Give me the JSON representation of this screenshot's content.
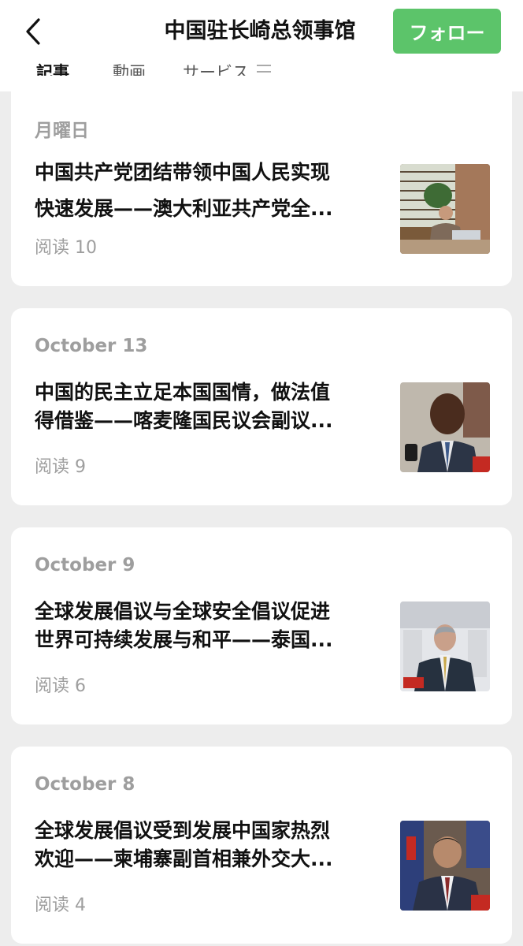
{
  "header": {
    "title": "中国驻长崎总领事馆",
    "follow_label": "フォロー",
    "back_icon": "chevron-left-icon"
  },
  "tabs": [
    {
      "label": "記事",
      "active": true
    },
    {
      "label": "動画",
      "active": false
    },
    {
      "label": "サービス",
      "active": false
    }
  ],
  "articles": [
    {
      "date": "月曜日",
      "title_line1": "中国共产党团结带领中国人民实现",
      "title_line2": "快速发展——澳大利亚共产党全...",
      "reads": "阅读 10"
    },
    {
      "date": "October 13",
      "title_line1": "中国的民主立足本国国情，做法值",
      "title_line2": "得借鉴——喀麦隆国民议会副议...",
      "reads": "阅读 9"
    },
    {
      "date": "October 9",
      "title_line1": "全球发展倡议与全球安全倡议促进",
      "title_line2": "世界可持续发展与和平——泰国...",
      "reads": "阅读 6"
    },
    {
      "date": "October 8",
      "title_line1": "全球发展倡议受到发展中国家热烈",
      "title_line2": "欢迎——柬埔寨副首相兼外交大...",
      "reads": "阅读 4"
    }
  ],
  "colors": {
    "accent_green": "#5cc46a",
    "background": "#ededed",
    "muted_text": "#9e9e9e"
  }
}
